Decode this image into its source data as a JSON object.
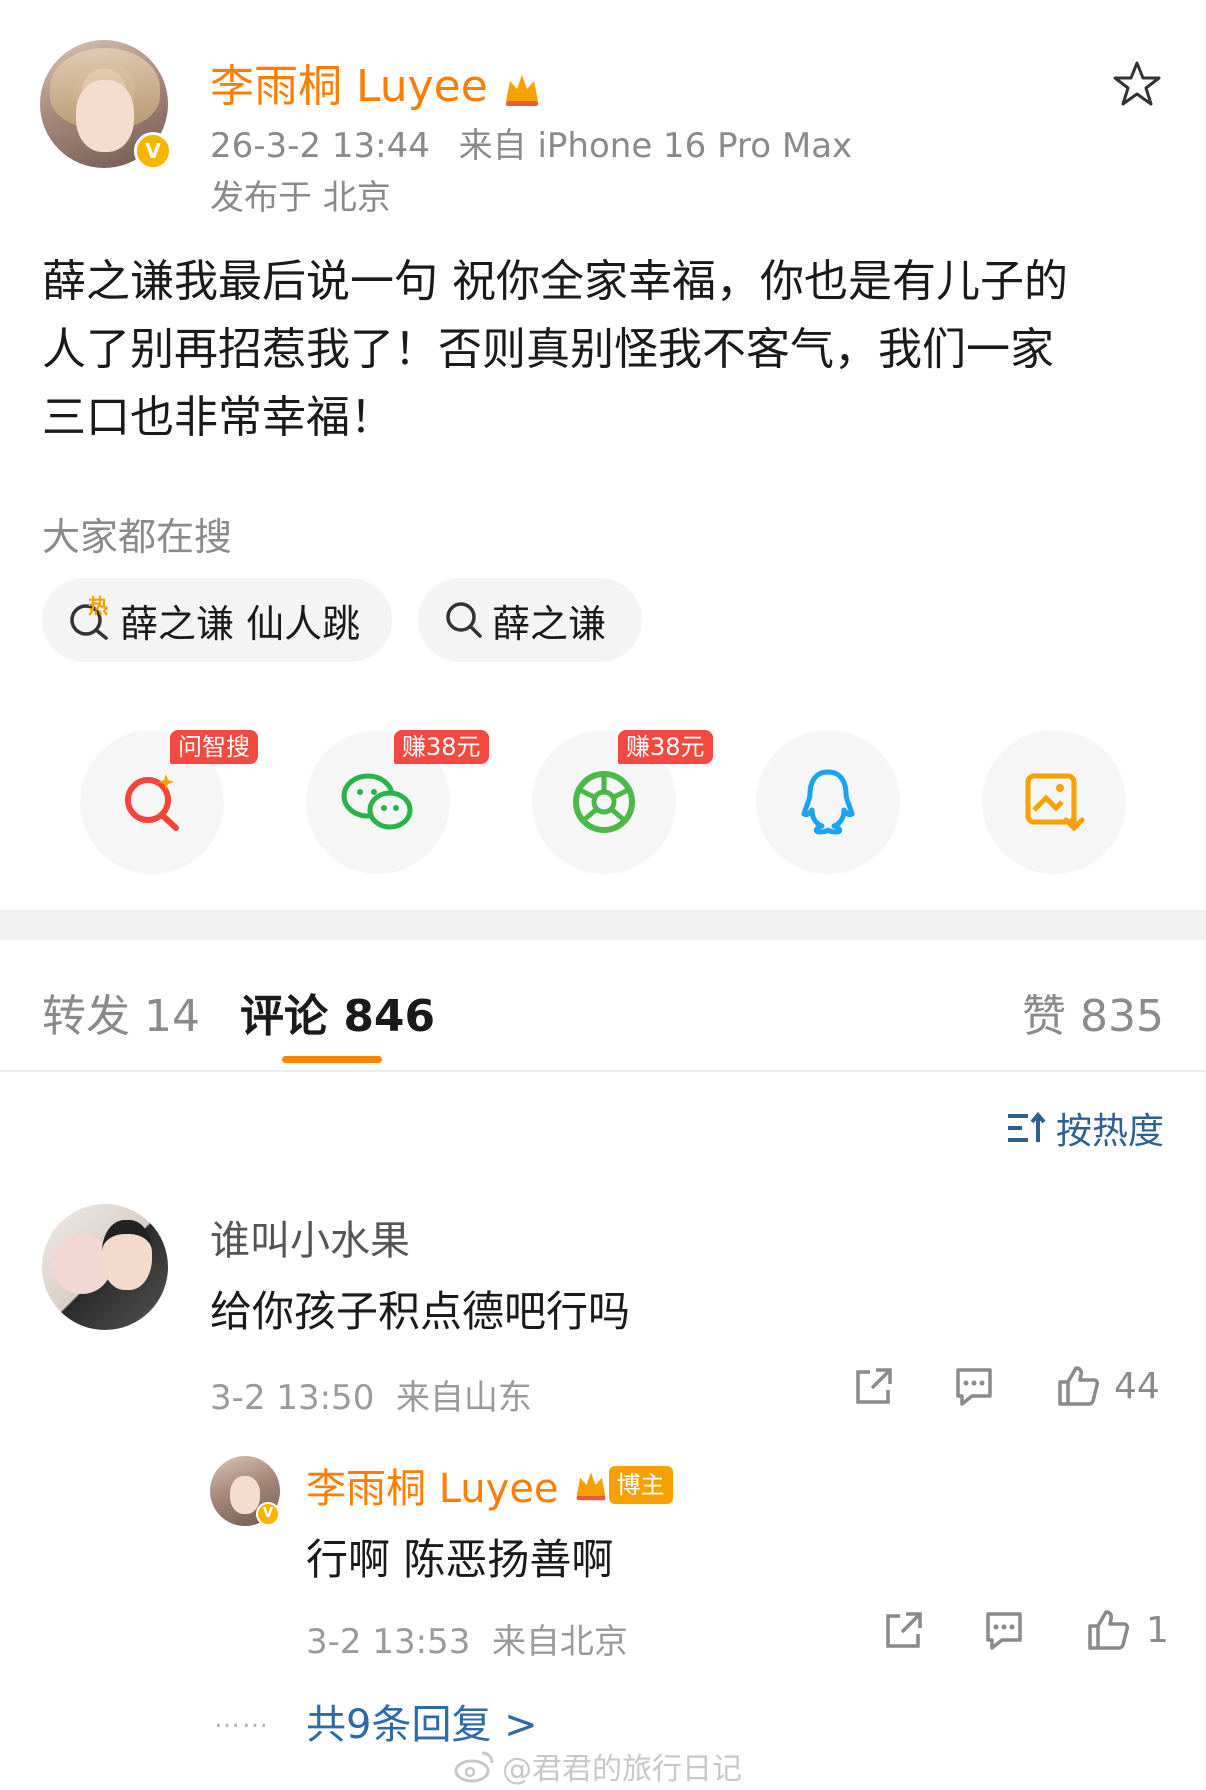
{
  "post": {
    "author": "李雨桐 Luyee",
    "timestamp": "26-3-2 13:44",
    "source": "来自 iPhone 16 Pro Max",
    "location": "发布于 北京",
    "text_line1": "薛之谦我最后说一句 祝你全家幸福，你也是有儿子的",
    "text_line2": "人了别再招惹我了！否则真别怪我不客气，我们一家",
    "text_line3": "三口也非常幸福！"
  },
  "search": {
    "heading": "大家都在搜",
    "hot_icon_label": "热",
    "items": [
      "薛之谦 仙人跳",
      "薛之谦"
    ]
  },
  "share": {
    "tags": [
      "问智搜",
      "赚38元",
      "赚38元"
    ],
    "icons": [
      "ai-search-icon",
      "wechat-icon",
      "moments-icon",
      "qq-icon",
      "save-image-icon"
    ]
  },
  "tabs": {
    "repost": "转发 14",
    "comments": "评论 846",
    "likes": "赞 835"
  },
  "sort": {
    "label": "按热度"
  },
  "comment": {
    "user": "谁叫小水果",
    "text": "给你孩子积点德吧行吗",
    "meta": "3-2 13:50  来自山东",
    "likes": "44"
  },
  "reply": {
    "user": "李雨桐 Luyee",
    "badge": "博主",
    "text": "行啊 陈恶扬善啊",
    "meta": "3-2 13:53  来自北京",
    "likes": "1",
    "dots": "……",
    "more": "共9条回复 >"
  },
  "watermark": "@君君的旅行日记",
  "colors": {
    "accent": "#ff7d00",
    "link": "#2f6aa8",
    "tag_red": "#f24a3f"
  }
}
